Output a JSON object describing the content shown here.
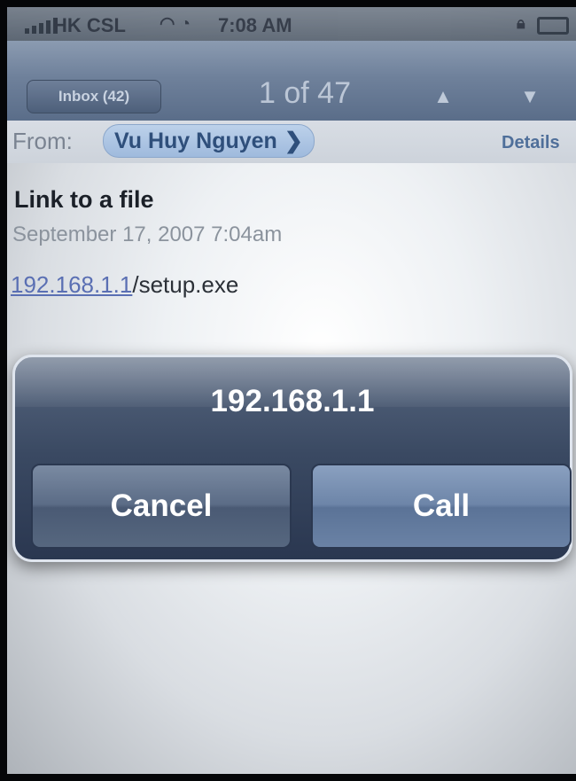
{
  "status_bar": {
    "carrier": "HK CSL",
    "time": "7:08 AM",
    "wifi_icon": "wifi-icon",
    "battery_icon": "battery-icon"
  },
  "nav": {
    "back_label": "Inbox (42)",
    "counter": "1 of 47",
    "prev_icon": "chevron-up-icon",
    "next_icon": "chevron-down-icon"
  },
  "message": {
    "from_label": "From:",
    "from_name": "Vu Huy Nguyen",
    "details_label": "Details",
    "subject": "Link to a file",
    "date": "September 17, 2007 7:04am",
    "body_link": "192.168.1.1",
    "body_suffix": "/setup.exe"
  },
  "alert": {
    "title": "192.168.1.1",
    "cancel_label": "Cancel",
    "call_label": "Call"
  },
  "colors": {
    "nav_bar": "#6f819b",
    "alert_bg": "#3a4962",
    "link": "#5a6fb3"
  }
}
